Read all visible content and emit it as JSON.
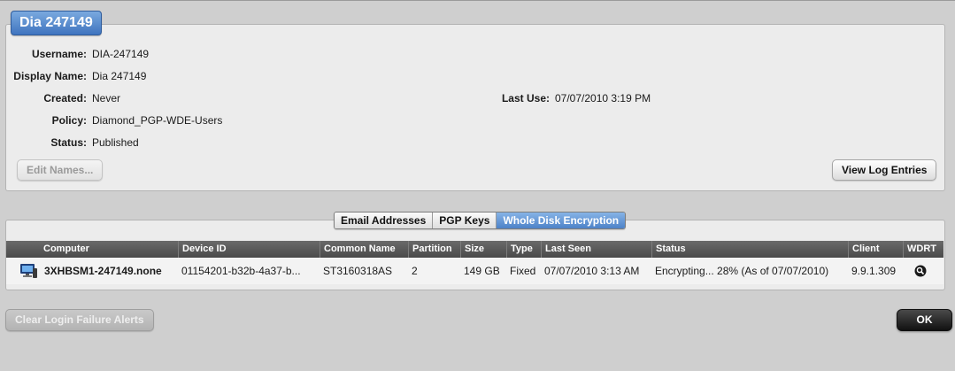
{
  "user": {
    "title": "Dia 247149",
    "fields": {
      "username": {
        "label": "Username:",
        "value": "DIA-247149"
      },
      "display_name": {
        "label": "Display Name:",
        "value": "Dia 247149"
      },
      "created": {
        "label": "Created:",
        "value": "Never"
      },
      "policy": {
        "label": "Policy:",
        "value": "Diamond_PGP-WDE-Users"
      },
      "status": {
        "label": "Status:",
        "value": "Published"
      },
      "last_use": {
        "label": "Last Use:",
        "value": "07/07/2010 3:19 PM"
      }
    },
    "edit_names_label": "Edit Names...",
    "view_log_label": "View Log Entries"
  },
  "tabs": [
    {
      "label": "Email Addresses",
      "active": false
    },
    {
      "label": "PGP Keys",
      "active": false
    },
    {
      "label": "Whole Disk Encryption",
      "active": true
    }
  ],
  "table": {
    "columns": [
      "Computer",
      "Device ID",
      "Common Name",
      "Partition",
      "Size",
      "Type",
      "Last Seen",
      "Status",
      "Client",
      "WDRT"
    ],
    "rows": [
      {
        "computer": "3XHBSM1-247149.none",
        "device_id": "01154201-b32b-4a37-b...",
        "common_name": "ST3160318AS",
        "partition": "2",
        "size": "149 GB",
        "type": "Fixed",
        "last_seen": "07/07/2010 3:13 AM",
        "status": "Encrypting... 28% (As of 07/07/2010)",
        "client": "9.9.1.309",
        "computer_icon": "computer-icon",
        "wdrt_icon": "magnifier-icon"
      }
    ]
  },
  "footer": {
    "clear_label": "Clear Login Failure Alerts",
    "ok_label": "OK"
  },
  "colors": {
    "accent": "#4d82c8",
    "header_bg": "#555555",
    "background": "#cfcfcf"
  }
}
